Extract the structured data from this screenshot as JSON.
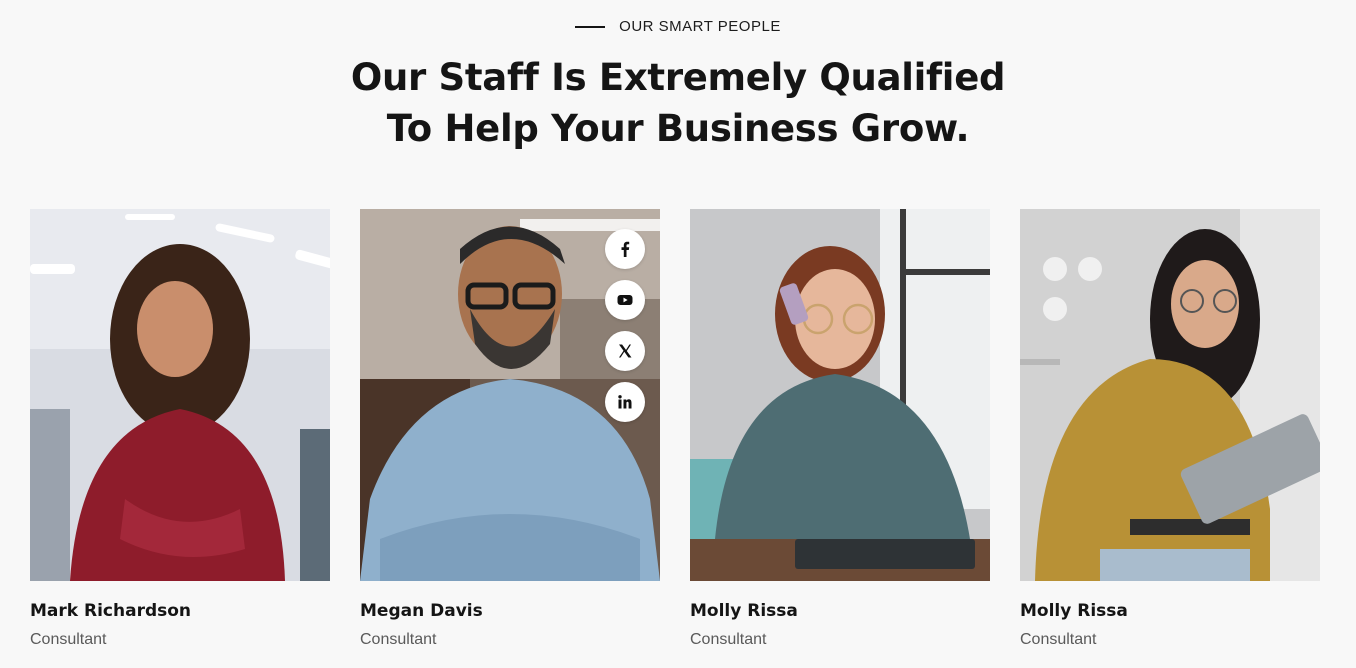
{
  "section": {
    "eyebrow": "OUR SMART PEOPLE",
    "title_line1": "Our Staff Is Extremely Qualified",
    "title_line2": "To Help Your Business Grow."
  },
  "team": [
    {
      "name": "Mark Richardson",
      "role": "Consultant"
    },
    {
      "name": "Megan Davis",
      "role": "Consultant"
    },
    {
      "name": "Molly Rissa",
      "role": "Consultant"
    },
    {
      "name": "Molly Rissa",
      "role": "Consultant"
    }
  ],
  "socials": [
    "facebook-icon",
    "youtube-icon",
    "x-twitter-icon",
    "linkedin-icon"
  ],
  "colors": {
    "background": "#f8f8f8",
    "text": "#151515",
    "muted": "#5a5a5a"
  }
}
